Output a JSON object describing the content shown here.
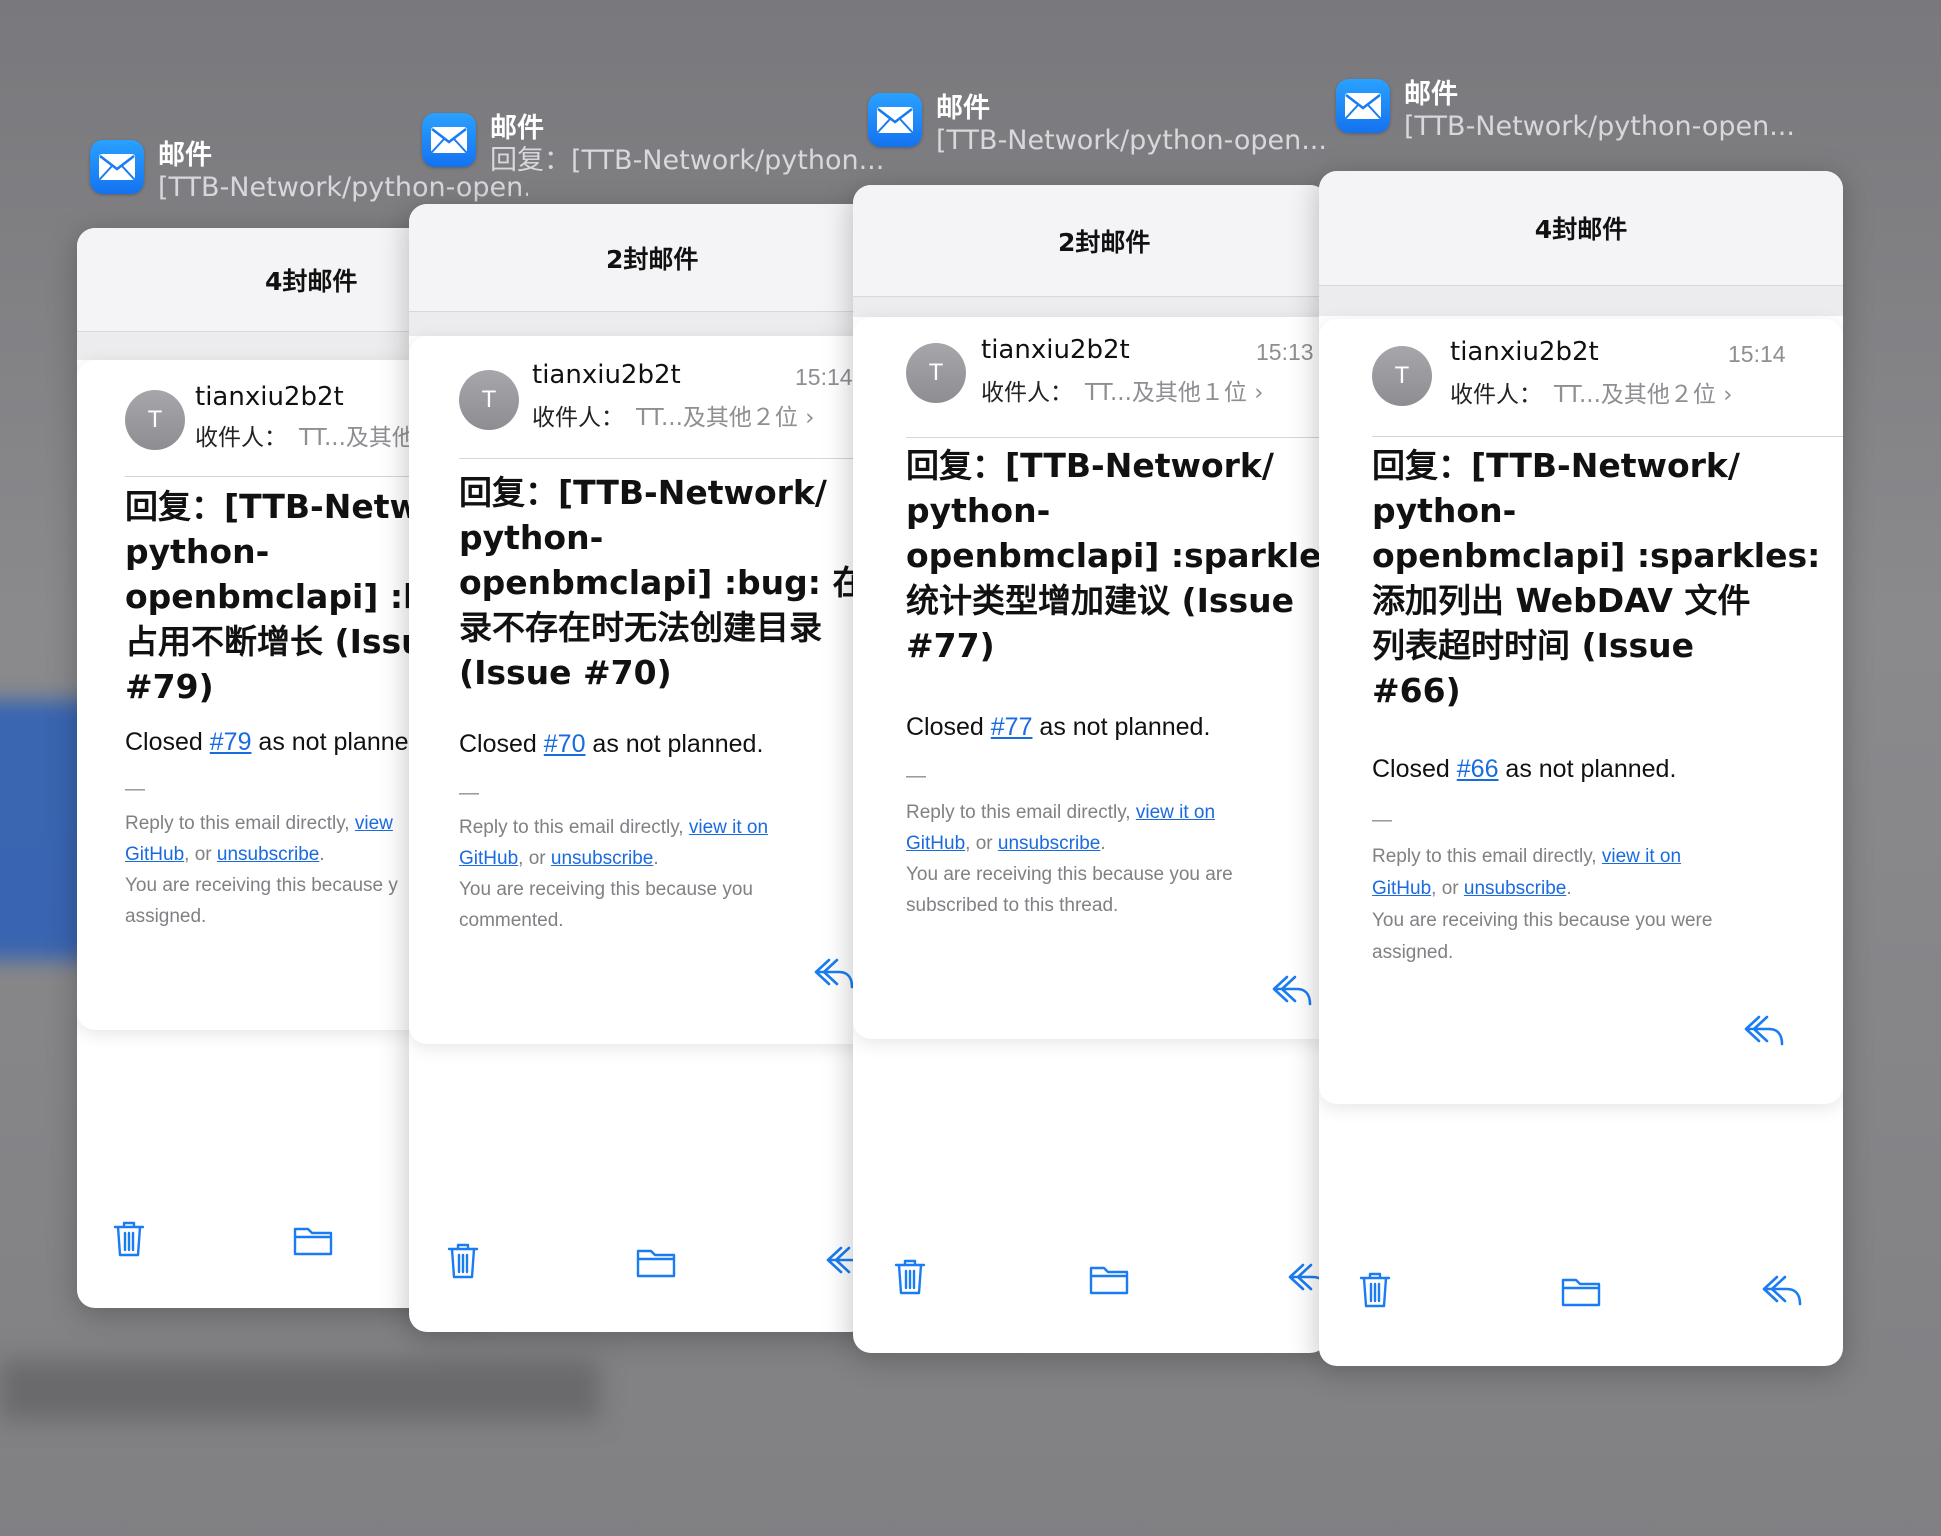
{
  "app": {
    "name": "邮件",
    "icon": "mail-icon",
    "accent": "#1a6ae0"
  },
  "cards": [
    {
      "app_subtitle": "[TTB-Network/python-open...",
      "count_title": "4封邮件",
      "sender": "tianxiu2b2t",
      "avatar_letter": "T",
      "recipients_label": "收件人：",
      "recipients_value": "TT...及其他",
      "subject_lines": [
        "回复：[TTB-Netwo",
        "python-",
        "openbmclapi] :bug",
        "占用不断增长 (Issue",
        "#79)"
      ],
      "closed_prefix": "Closed ",
      "closed_link": "#79",
      "closed_suffix": " as not planne",
      "dash": "—",
      "footer_line1_prefix": "Reply to this email directly, ",
      "footer_link1a": "view",
      "footer_link1b": "GitHub",
      "footer_or": ", or ",
      "footer_link2": "unsubscribe",
      "footer_period": ".",
      "footer_reason": "You are receiving this because y",
      "footer_reason2": "assigned."
    },
    {
      "app_subtitle": "回复：[TTB-Network/python...",
      "count_title": "2封邮件",
      "sender": "tianxiu2b2t",
      "time": "15:14",
      "avatar_letter": "T",
      "recipients_label": "收件人：",
      "recipients_value": "TT...及其他２位 ›",
      "subject_lines": [
        "回复：[TTB-Network/",
        "python-",
        "openbmclapi] :bug: 在目",
        "录不存在时无法创建目录",
        "(Issue #70)"
      ],
      "closed_prefix": "Closed ",
      "closed_link": "#70",
      "closed_suffix": " as not planned.",
      "dash": "—",
      "footer_line1_prefix": "Reply to this email directly, ",
      "footer_link1a": "view it on",
      "footer_link1b": "GitHub",
      "footer_or": ", or ",
      "footer_link2": "unsubscribe",
      "footer_period": ".",
      "footer_reason": "You are receiving this because you",
      "footer_reason2": "commented."
    },
    {
      "app_subtitle": "[TTB-Network/python-open...",
      "count_title": "2封邮件",
      "sender": "tianxiu2b2t",
      "time": "15:13",
      "avatar_letter": "T",
      "recipients_label": "收件人：",
      "recipients_value": "TT...及其他１位 ›",
      "subject_lines": [
        "回复：[TTB-Network/",
        "python-",
        "openbmclapi] :sparkles:",
        "统计类型增加建议 (Issue",
        "#77)"
      ],
      "closed_prefix": "Closed ",
      "closed_link": "#77",
      "closed_suffix": " as not planned.",
      "dash": "—",
      "footer_line1_prefix": "Reply to this email directly, ",
      "footer_link1a": "view it on",
      "footer_link1b": "GitHub",
      "footer_or": ", or ",
      "footer_link2": "unsubscribe",
      "footer_period": ".",
      "footer_reason": "You are receiving this because you are",
      "footer_reason2": "subscribed to this thread."
    },
    {
      "app_subtitle": "[TTB-Network/python-open...",
      "count_title": "4封邮件",
      "sender": "tianxiu2b2t",
      "time": "15:14",
      "avatar_letter": "T",
      "recipients_label": "收件人：",
      "recipients_value": "TT...及其他２位 ›",
      "subject_lines": [
        "回复：[TTB-Network/",
        "python-",
        "openbmclapi] :sparkles:",
        "添加列出 WebDAV 文件",
        "列表超时时间 (Issue",
        "#66)"
      ],
      "closed_prefix": "Closed ",
      "closed_link": "#66",
      "closed_suffix": " as not planned.",
      "dash": "—",
      "footer_line1_prefix": "Reply to this email directly, ",
      "footer_link1a": "view it on",
      "footer_link1b": "GitHub",
      "footer_or": ", or ",
      "footer_link2": "unsubscribe",
      "footer_period": ".",
      "footer_reason": "You are receiving this because you were",
      "footer_reason2": "assigned."
    }
  ],
  "toolbar_icons": [
    "trash-icon",
    "folder-icon",
    "reply-icon"
  ]
}
